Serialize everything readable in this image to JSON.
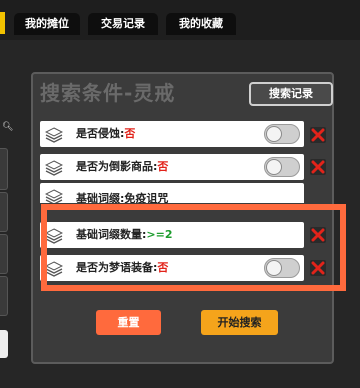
{
  "tabs": [
    {
      "label": "我的摊位"
    },
    {
      "label": "交易记录"
    },
    {
      "label": "我的收藏"
    }
  ],
  "panel": {
    "title": "搜索条件-灵戒",
    "history_button": "搜索记录"
  },
  "conditions": [
    {
      "label": "是否侵蚀:",
      "value": "否",
      "value_color": "red",
      "has_toggle": true,
      "toggle_on": false
    },
    {
      "label": "是否为倒影商品:",
      "value": "否",
      "value_color": "red",
      "has_toggle": true,
      "toggle_on": false
    },
    {
      "label": "基础词缀:免疫诅咒",
      "value": "",
      "has_toggle": false
    },
    {
      "label": "基础词缀数量:",
      "value": ">=2",
      "value_color": "green",
      "has_toggle": false
    },
    {
      "label": "是否为梦语装备:",
      "value": "否",
      "value_color": "red",
      "has_toggle": true,
      "toggle_on": false
    }
  ],
  "actions": {
    "reset": "重置",
    "search": "开始搜索"
  },
  "colors": {
    "highlight": "#ff6a3d",
    "reset": "#ff6a3d",
    "search": "#f5a41b",
    "delete": "#e2231a",
    "tab_accent": "#f2c200"
  }
}
